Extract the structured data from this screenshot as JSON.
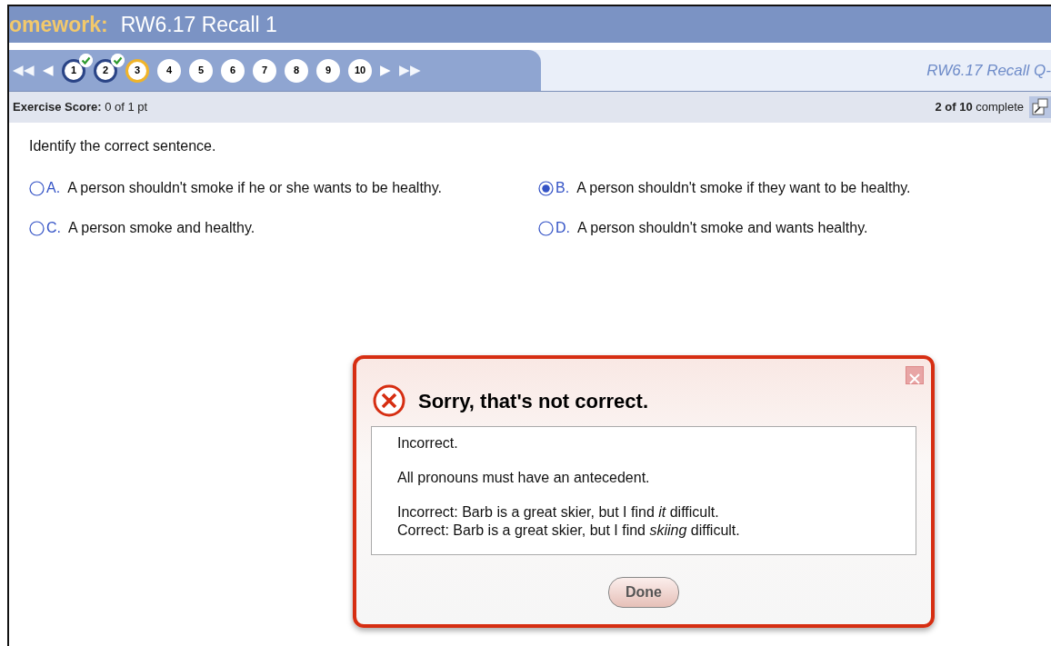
{
  "header": {
    "label": "omework:",
    "title": "RW6.17 Recall 1"
  },
  "nav": {
    "first": "◀◀",
    "prev": "◀",
    "next": "▶",
    "last": "▶▶",
    "questions": [
      {
        "label": "1",
        "done": true,
        "selected": false
      },
      {
        "label": "2",
        "done": true,
        "selected": false
      },
      {
        "label": "3",
        "done": false,
        "selected": true
      },
      {
        "label": "4",
        "done": false,
        "selected": false
      },
      {
        "label": "5",
        "done": false,
        "selected": false
      },
      {
        "label": "6",
        "done": false,
        "selected": false
      },
      {
        "label": "7",
        "done": false,
        "selected": false
      },
      {
        "label": "8",
        "done": false,
        "selected": false
      },
      {
        "label": "9",
        "done": false,
        "selected": false
      },
      {
        "label": "10",
        "done": false,
        "selected": false
      }
    ],
    "question_title": "RW6.17 Recall Q-"
  },
  "score": {
    "label": "Exercise Score:",
    "value": "0 of 1 pt",
    "progress": "2 of 10",
    "progress_suffix": "complete"
  },
  "question": "Identify the correct sentence.",
  "options": [
    {
      "letter": "A.",
      "text": "A person shouldn't smoke if he or she wants to be healthy.",
      "selected": false
    },
    {
      "letter": "B.",
      "text": "A person shouldn't smoke if they want to be healthy.",
      "selected": true
    },
    {
      "letter": "C.",
      "text": "A person smoke and healthy.",
      "selected": false
    },
    {
      "letter": "D.",
      "text": "A person shouldn't smoke and wants healthy.",
      "selected": false
    }
  ],
  "dialog": {
    "title": "Sorry, that's not correct.",
    "paragraphs": [
      "Incorrect.",
      "All pronouns must have an antecedent.",
      "Incorrect: Barb is a great skier, but I find *it* difficult.\nCorrect: Barb is a great skier, but I find *skiing* difficult."
    ],
    "button": "Done"
  }
}
